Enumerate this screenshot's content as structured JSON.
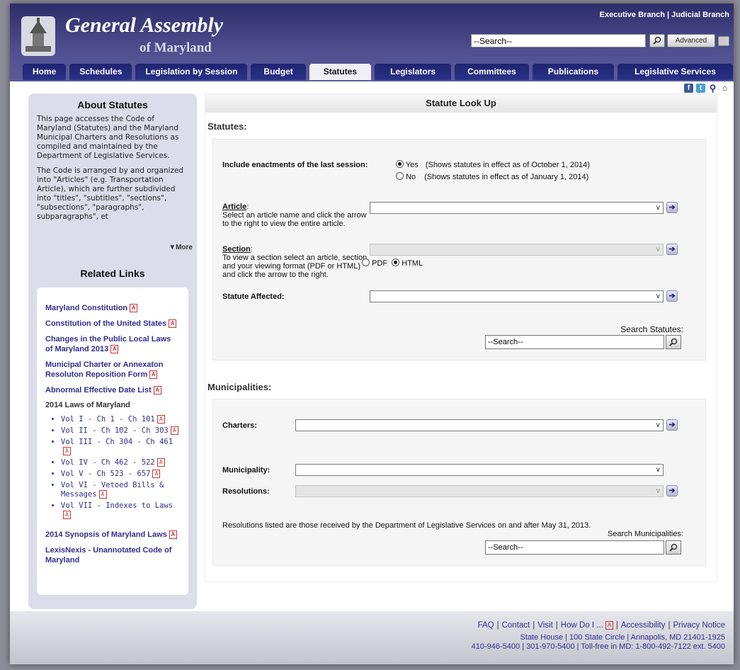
{
  "header": {
    "brand_title": "General Assembly",
    "brand_subtitle": "of Maryland",
    "branch_links": [
      "Executive Branch",
      "Judicial Branch"
    ],
    "search_placeholder": "--Search--",
    "advanced_label": "Advanced"
  },
  "tabs": [
    {
      "label": "Home",
      "active": false
    },
    {
      "label": "Schedules",
      "active": false
    },
    {
      "label": "Legislation by Session",
      "active": false
    },
    {
      "label": "Budget",
      "active": false
    },
    {
      "label": "Statutes",
      "active": true
    },
    {
      "label": "Legislators",
      "active": false
    },
    {
      "label": "Committees",
      "active": false
    },
    {
      "label": "Publications",
      "active": false
    },
    {
      "label": "Legislative Services",
      "active": false
    }
  ],
  "sidebar": {
    "about_title": "About Statutes",
    "about_p1": "This page accesses the Code of Maryland (Statutes) and the Maryland Municipal Charters and Resolutions as compiled and maintained by the Department of Legislative Services.",
    "about_p2": "The Code is arranged by and organized into \"Articles\" (e.g. Transportation Article), which are further subdivided into \"titles\", \"subtitles\", \"sections\", \"subsections\", \"paragraphs\", subparagraphs\", et",
    "more_label": "▼More",
    "related_title": "Related Links",
    "links": [
      "Maryland Constitution",
      "Constitution of the United States",
      "Changes in the Public Local Laws of Maryland 2013",
      "Municipal Charter or Annexaton Resoluton Reposition Form",
      "Abnormal Effective Date List"
    ],
    "laws_heading": "2014 Laws of Maryland",
    "volumes": [
      "Vol I - Ch 1 - Ch 101",
      "Vol II - Ch 102 - Ch 303",
      "Vol III - Ch 304 - Ch 461",
      "Vol IV - Ch 462 - 522",
      "Vol V - Ch 523 - 657",
      "Vol VI - Vetoed Bills & Messages",
      "Vol VII - Indexes to Laws"
    ],
    "synopsis_link": "2014 Synopsis of Maryland Laws",
    "lexis_link": "LexisNexis - Unannotated Code of Maryland"
  },
  "main": {
    "title": "Statute Look Up",
    "statutes_heading": "Statutes:",
    "include_label": "Include enactments of the last session:",
    "yes_label": "Yes",
    "yes_desc": "(Shows statutes in effect as of October 1, 2014)",
    "no_label": "No",
    "no_desc": "(Shows statutes in effect as of January 1, 2014)",
    "article_label": "Article",
    "article_help": "Select an article name and click the arrow to the right to view the entire article.",
    "section_label": "Section",
    "section_help": "To view a section select an article, section and your viewing format (PDF or HTML) and click the arrow to the right.",
    "pdf_label": "PDF",
    "html_label": "HTML",
    "affected_label": "Statute Affected:",
    "search_statutes_label": "Search Statutes:",
    "search_placeholder": "--Search--",
    "municipalities_heading": "Municipalities:",
    "charters_label": "Charters:",
    "municipality_label": "Municipality:",
    "resolutions_label": "Resolutions:",
    "resolutions_note": "Resolutions listed are those received by the Department of Legislative Services on and after May 31, 2013.",
    "search_muni_label": "Search Municipalities:"
  },
  "footer": {
    "links": [
      "FAQ",
      "Contact",
      "Visit",
      "How Do I ...",
      "Accessibility",
      "Privacy Notice"
    ],
    "address": "State House | 100 State Circle | Annapolis, MD 21401-1925",
    "phones": "410-946-5400 | 301-970-5400 | Toll-free in MD: 1-800-492-7122 ext. 5400"
  },
  "colors": {
    "header": "#3d3d7d",
    "tab": "#1e2470",
    "link": "#2f2f8f",
    "sidebar": "#dcdcea"
  }
}
